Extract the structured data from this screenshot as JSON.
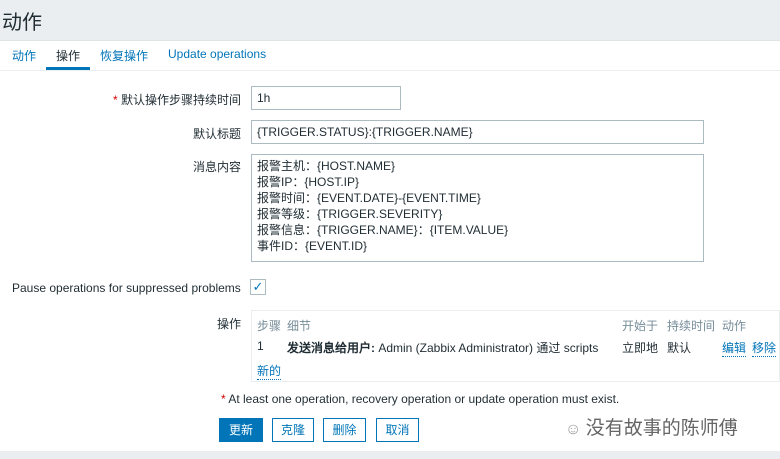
{
  "title": "动作",
  "tabs": [
    "动作",
    "操作",
    "恢复操作",
    "Update operations"
  ],
  "form": {
    "duration_label": "默认操作步骤持续时间",
    "duration_value": "1h",
    "subject_label": "默认标题",
    "subject_value": "{TRIGGER.STATUS}:{TRIGGER.NAME}",
    "message_label": "消息内容",
    "message_value": "报警主机：{HOST.NAME}\n报警IP：{HOST.IP}\n报警时间：{EVENT.DATE}-{EVENT.TIME}\n报警等级：{TRIGGER.SEVERITY}\n报警信息：{TRIGGER.NAME}：{ITEM.VALUE}\n事件ID：{EVENT.ID}",
    "pause_label": "Pause operations for suppressed problems",
    "pause_checked": true,
    "ops_label": "操作"
  },
  "ops": {
    "headers": {
      "step": "步骤",
      "details": "细节",
      "start": "开始于",
      "duration": "持续时间",
      "action": "动作"
    },
    "row": {
      "step": "1",
      "details_bold": "发送消息给用户:",
      "details": " Admin (Zabbix Administrator) 通过 scripts",
      "start": "立即地",
      "duration": "默认",
      "edit": "编辑",
      "remove": "移除"
    },
    "new": "新的"
  },
  "note": "At least one operation, recovery operation or update operation must exist.",
  "buttons": {
    "update": "更新",
    "clone": "克隆",
    "delete": "删除",
    "cancel": "取消"
  },
  "watermark": "没有故事的陈师傅"
}
